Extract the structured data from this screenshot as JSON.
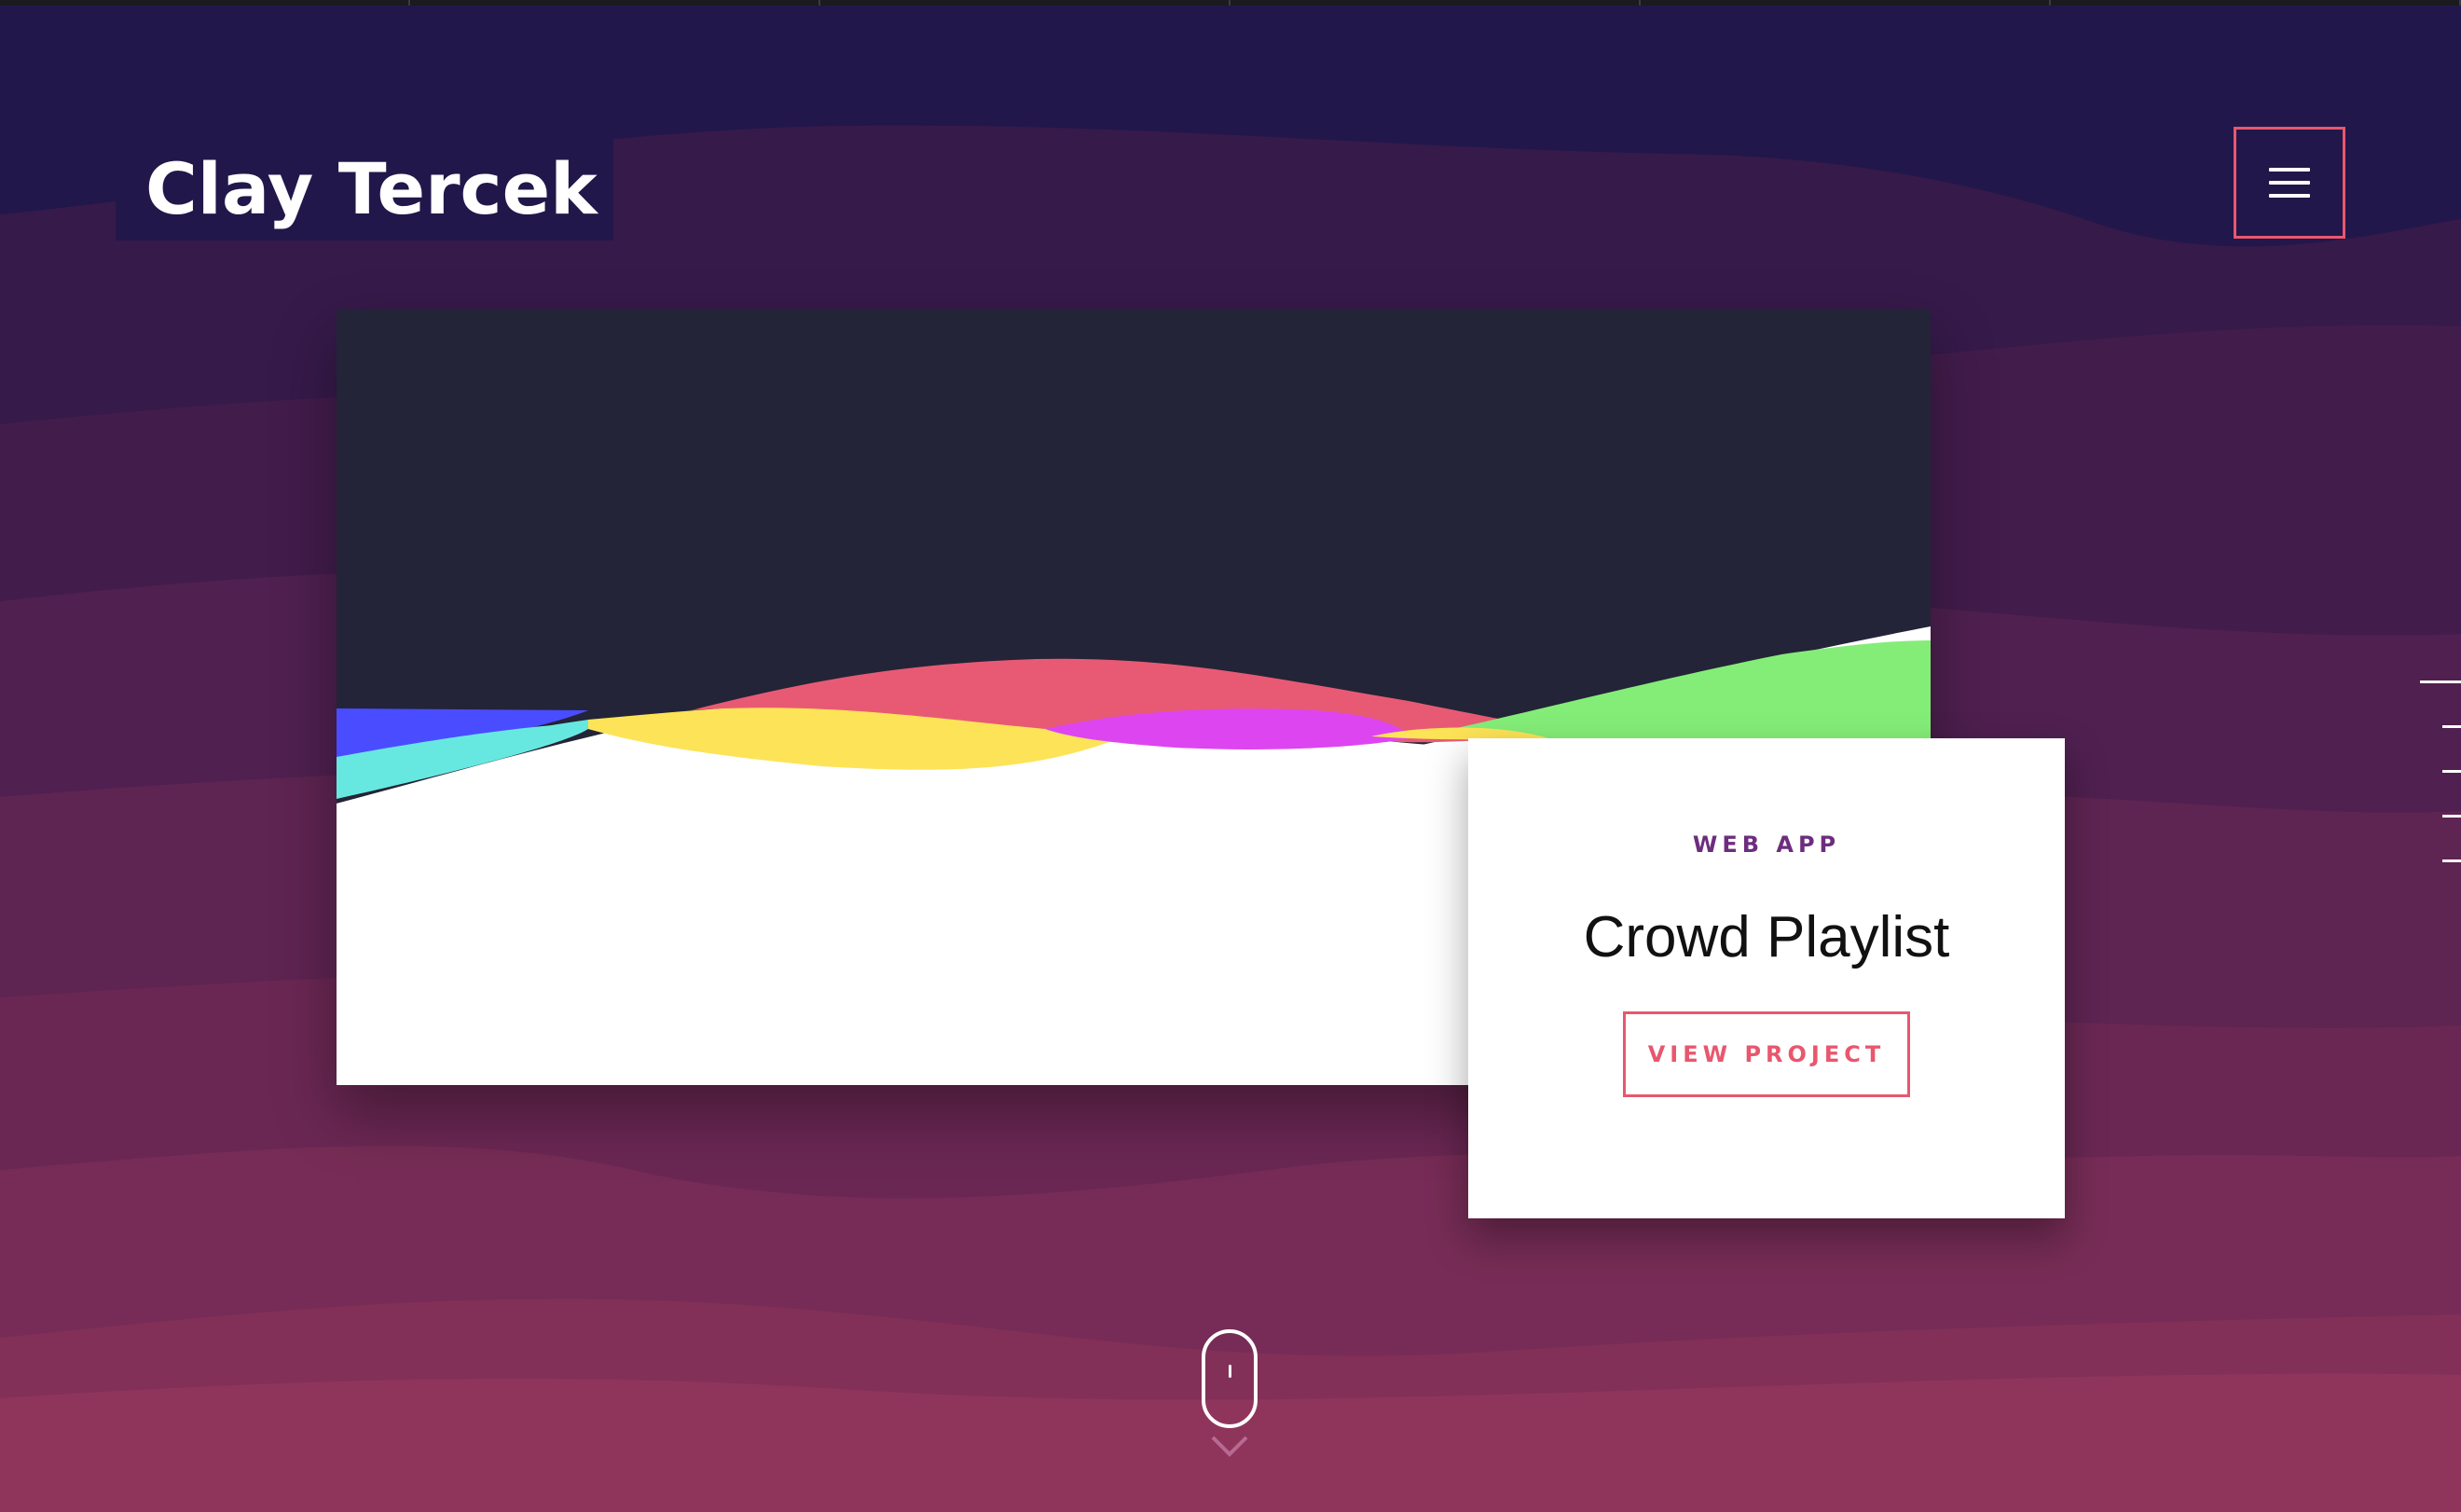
{
  "site": {
    "logo_text": "Clay Tercek"
  },
  "header": {
    "menu_icon": "hamburger-menu-icon"
  },
  "project": {
    "category": "WEB APP",
    "title": "Crowd Playlist",
    "button_label": "VIEW PROJECT"
  },
  "side_nav": {
    "item_count": 5,
    "active_index": 0
  },
  "scroll_indicator": {
    "icon": "mouse-scroll-icon",
    "arrow_icon": "chevron-down-icon"
  },
  "colors": {
    "background_top": "#22174a",
    "background_bottom": "#8f355c",
    "accent": "#e8576e",
    "category_text": "#6d2d7e",
    "project_dark": "#232437",
    "wave_blue": "#4a4dff",
    "wave_cyan": "#66e8e0",
    "wave_yellow": "#fde357",
    "wave_red": "#e85a74",
    "wave_magenta": "#dd45f0",
    "wave_green": "#84ed78"
  }
}
